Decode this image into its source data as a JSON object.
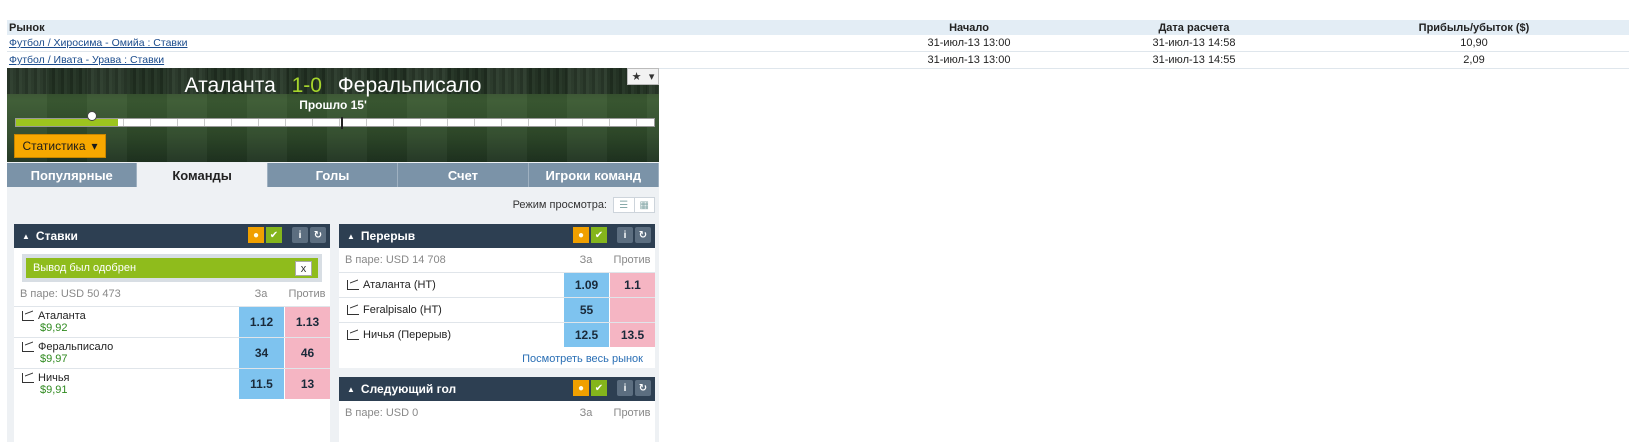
{
  "results": {
    "headers": {
      "market": "Рынок",
      "start": "Начало",
      "settle": "Дата расчета",
      "pl": "Прибыль/убыток ($)"
    },
    "rows": [
      {
        "market": "Футбол / Хиросима - Омийа : Ставки",
        "start": "31-июл-13 13:00",
        "settle": "31-июл-13 14:58",
        "pl": "10,90"
      },
      {
        "market": "Футбол / Ивата - Урава : Ставки",
        "start": "31-июл-13 13:00",
        "settle": "31-июл-13 14:55",
        "pl": "2,09"
      }
    ]
  },
  "scoreboard": {
    "home": "Аталанта",
    "score": "1-0",
    "away": "Феральписало",
    "elapsed": "Прошло 15'",
    "progress_fraction": 0.16,
    "fav_icon": "star-icon",
    "stats_label": "Статистика"
  },
  "tabs": [
    "Популярные",
    "Команды",
    "Голы",
    "Счет",
    "Игроки команд"
  ],
  "active_tab": 1,
  "view_mode_label": "Режим просмотра:",
  "panels": {
    "bets": {
      "title": "Ставки",
      "approved_message": "Вывод был одобрен",
      "close_label": "x",
      "pair_label": "В паре: USD 50 473",
      "col_for": "За",
      "col_against": "Против",
      "selections": [
        {
          "name": "Аталанта",
          "pl": "$9,92",
          "back": "1.12",
          "lay": "1.13"
        },
        {
          "name": "Феральписало",
          "pl": "$9,97",
          "back": "34",
          "lay": "46"
        },
        {
          "name": "Ничья",
          "pl": "$9,91",
          "back": "11.5",
          "lay": "13"
        }
      ]
    },
    "halftime": {
      "title": "Перерыв",
      "pair_label": "В паре: USD 14 708",
      "col_for": "За",
      "col_against": "Против",
      "selections": [
        {
          "name": "Аталанта (HT)",
          "back": "1.09",
          "lay": "1.1"
        },
        {
          "name": "Feralpisalo (HT)",
          "back": "55",
          "lay": ""
        },
        {
          "name": "Ничья (Перерыв)",
          "back": "12.5",
          "lay": "13.5"
        }
      ],
      "view_all": "Посмотреть весь рынок"
    },
    "next_goal": {
      "title": "Следующий гол",
      "pair_label": "В паре: USD 0",
      "col_for": "За",
      "col_against": "Против"
    }
  },
  "colors": {
    "accent": "#f7a800",
    "header": "#2d3f52",
    "back": "#7ec3ef",
    "lay": "#f5b5c3",
    "approved": "#8fbc1c"
  }
}
